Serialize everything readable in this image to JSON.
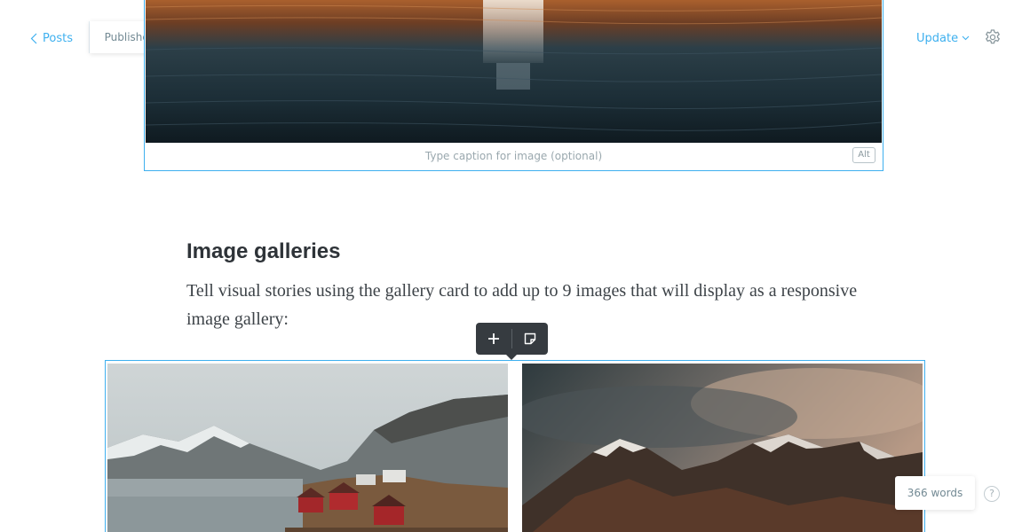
{
  "header": {
    "back_label": "Posts",
    "status": "Published",
    "update_label": "Update"
  },
  "image_card": {
    "caption_placeholder": "Type caption for image (optional)",
    "alt_label": "Alt"
  },
  "content": {
    "heading": "Image galleries",
    "paragraph": "Tell visual stories using the gallery card to add up to 9 images that will display as a responsive image gallery:"
  },
  "footer": {
    "word_count": "366 words",
    "help_label": "?"
  },
  "colors": {
    "accent": "#3eb0ef",
    "toolbar_bg": "#363b40",
    "muted_text": "#738a94"
  },
  "icons": {
    "back": "chevron-left-icon",
    "update": "chevron-down-icon",
    "settings": "gear-icon",
    "toolbar_add": "plus-icon",
    "toolbar_snippet": "sticky-note-icon",
    "help": "question-circle-icon"
  }
}
